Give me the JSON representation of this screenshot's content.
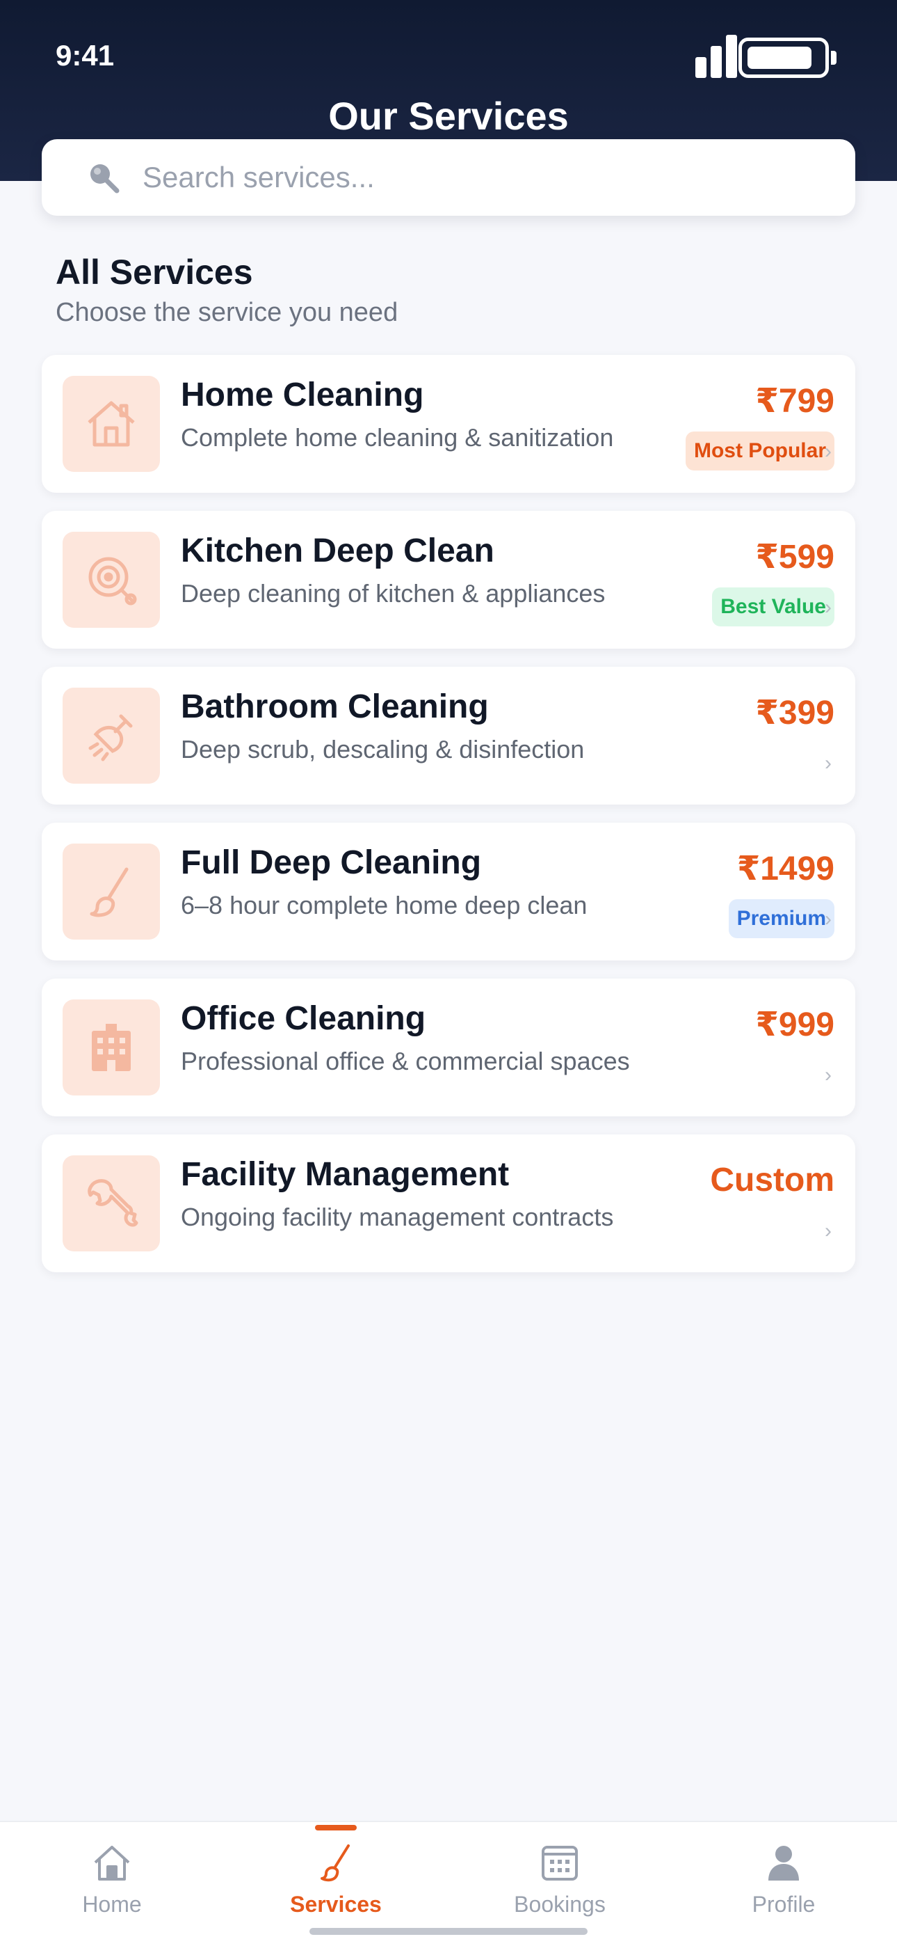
{
  "status_bar": {
    "time": "9:41"
  },
  "header": {
    "title": "Our Services"
  },
  "search": {
    "placeholder": "Search services..."
  },
  "section": {
    "title": "All Services",
    "subtitle": "Choose the service you need"
  },
  "services": [
    {
      "name": "Home Cleaning",
      "description": "Complete home cleaning & sanitization",
      "price": "₹799",
      "badge": "Most Popular",
      "badge_color": "#e04e10",
      "icon": "house-icon"
    },
    {
      "name": "Kitchen Deep Clean",
      "description": "Deep cleaning of kitchen & appliances",
      "price": "₹599",
      "badge": "Best Value",
      "badge_color": "#1fb45a",
      "icon": "stove-icon"
    },
    {
      "name": "Bathroom Cleaning",
      "description": "Deep scrub, descaling & disinfection",
      "price": "₹399",
      "badge": "",
      "icon": "shower-icon"
    },
    {
      "name": "Full Deep Cleaning",
      "description": "6–8 hour complete home deep clean",
      "price": "₹1499",
      "badge": "Premium",
      "badge_color": "#2f6fd8",
      "icon": "brush-icon"
    },
    {
      "name": "Office Cleaning",
      "description": "Professional office & commercial spaces",
      "price": "₹999",
      "badge": "",
      "icon": "building-icon"
    },
    {
      "name": "Facility Management",
      "description": "Ongoing facility management contracts",
      "price": "Custom",
      "badge": "",
      "icon": "wrench-icon"
    }
  ],
  "tabbar": {
    "items": [
      {
        "label": "Home",
        "icon": "home-icon",
        "active": false
      },
      {
        "label": "Services",
        "icon": "brush-icon",
        "active": true
      },
      {
        "label": "Bookings",
        "icon": "calendar-icon",
        "active": false
      },
      {
        "label": "Profile",
        "icon": "person-icon",
        "active": false
      }
    ]
  },
  "colors": {
    "header_bg": "#101a32",
    "accent": "#e65a1c",
    "icon_tile": "#fde6dc",
    "background": "#f6f7fb"
  }
}
